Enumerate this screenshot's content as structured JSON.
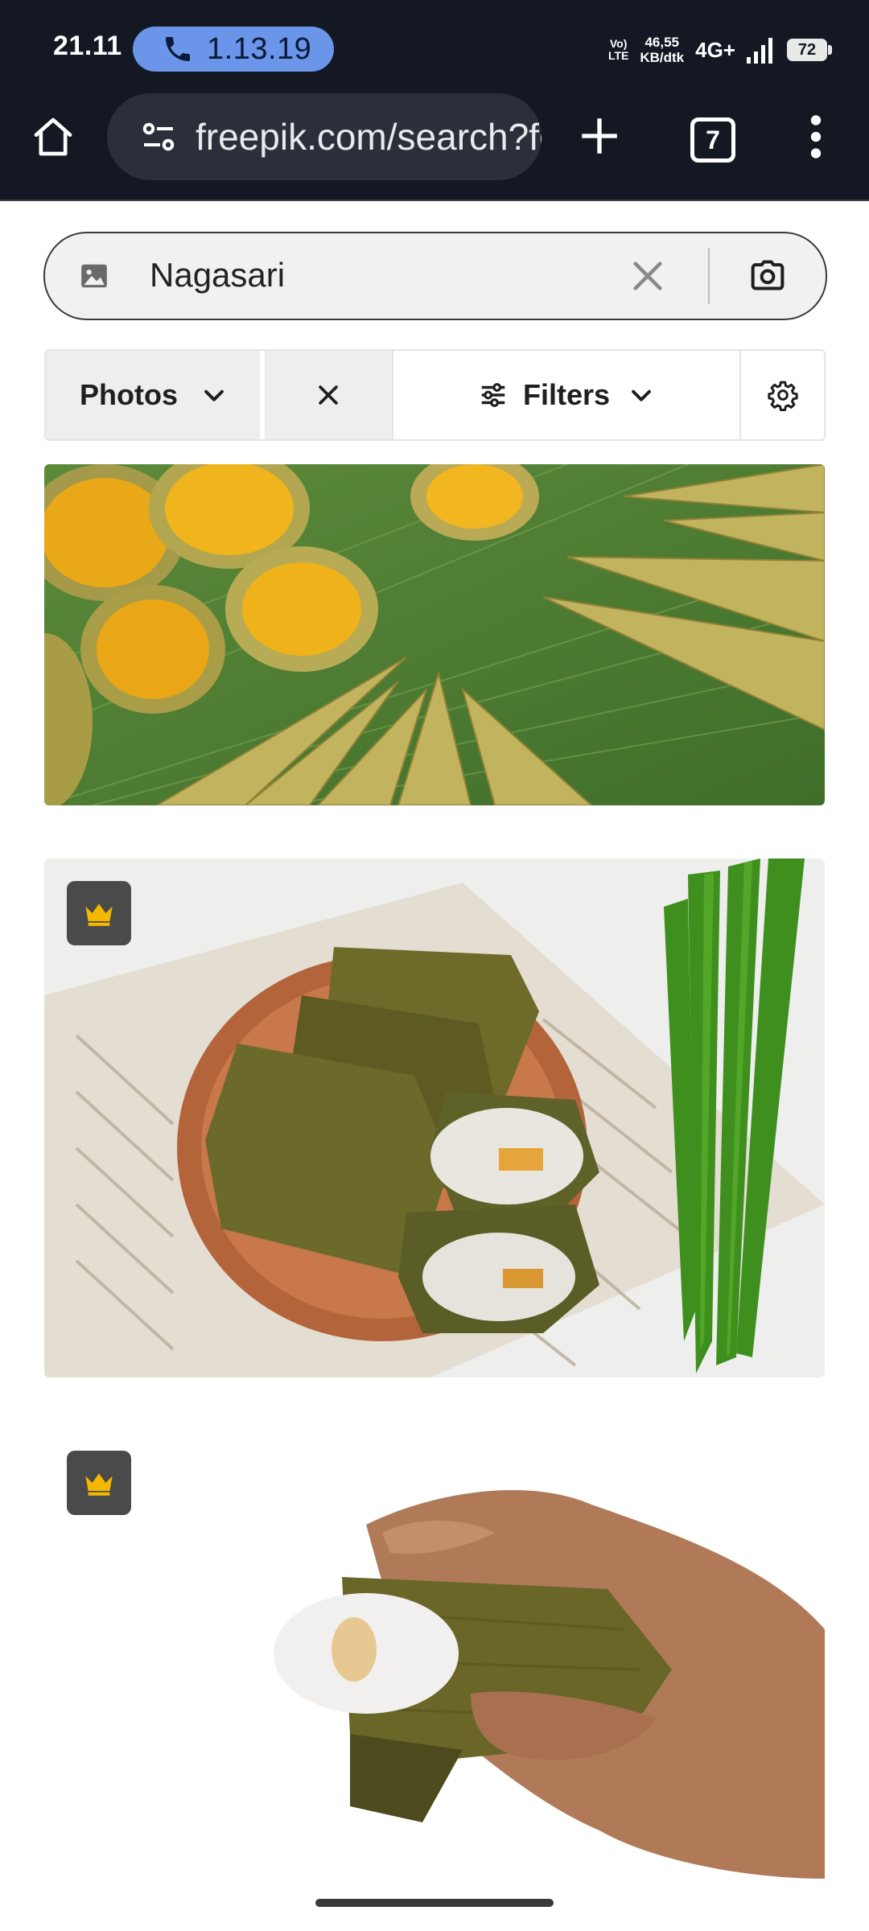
{
  "status_bar": {
    "time": "21.11",
    "call_timer": "1.13.19",
    "volte_top": "Vo)",
    "volte_bottom": "LTE",
    "net_speed_value": "46,55",
    "net_speed_unit": "KB/dtk",
    "network": "4G+",
    "battery": "72"
  },
  "browser": {
    "url": "freepik.com/search?format=search&query=Nagasari",
    "tab_count": "7"
  },
  "search": {
    "query": "Nagasari"
  },
  "filters": {
    "type_label": "Photos",
    "filters_label": "Filters"
  },
  "results": [
    {
      "premium": false,
      "subject": "nagasari cones on banana leaf"
    },
    {
      "premium": true,
      "subject": "wrapped nagasari on wooden plate with pandan leaves"
    },
    {
      "premium": true,
      "subject": "hand holding opened nagasari"
    }
  ],
  "colors": {
    "status_bg": "#141823",
    "call_pill": "#6b95e8",
    "premium_crown": "#f5b800",
    "premium_badge_bg": "#4a4a4a"
  }
}
